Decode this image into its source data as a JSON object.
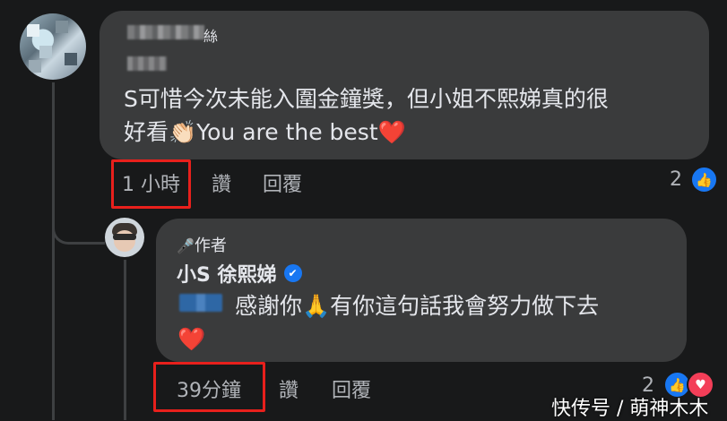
{
  "comment1": {
    "name_visible_suffix": "絲",
    "text_line1": "S可惜今次未能入圍金鐘獎，但小姐不熙娣真的很",
    "text_line2_pre": "好看",
    "text_line2_emoji": "👏🏻",
    "text_line2_post": "You are the best",
    "text_line2_heart": "❤️",
    "time": "1 小時",
    "like_label": "讚",
    "reply_label": "回覆",
    "reaction_count": "2",
    "reaction_icon": "thumbs-up"
  },
  "reply1": {
    "author_badge_icon": "🎤",
    "author_badge": "作者",
    "name": "小S 徐熙娣",
    "verified_icon": "✔",
    "text_pre": "感謝你",
    "text_emoji": "🙏",
    "text_post": "有你這句話我會努力做下去",
    "text_heart": "❤️",
    "time": "39分鐘",
    "like_label": "讚",
    "reply_label": "回覆",
    "reaction_count": "2",
    "reaction_icons": [
      "thumbs-up",
      "heart"
    ]
  },
  "watermark": "快传号 / 萌神木木",
  "colors": {
    "background": "#18191a",
    "bubble": "#3a3b3c",
    "text": "#e4e6eb",
    "muted": "#b0b3b8",
    "highlight_box": "#e8201c",
    "like_blue": "#1877f2",
    "love_red": "#f33e58"
  }
}
